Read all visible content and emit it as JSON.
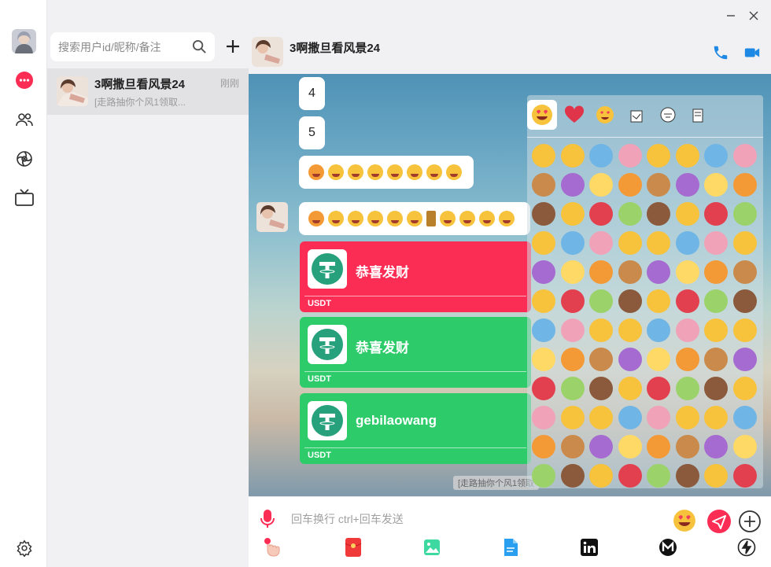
{
  "sidebar": {
    "search_placeholder": "搜索用户id/昵称/备注"
  },
  "contacts": [
    {
      "name": "3啊撒旦看风景24",
      "time": "刚刚",
      "preview": "[走路抽你个风1领取..."
    }
  ],
  "chat": {
    "title": "3啊撒旦看风景24",
    "messages": [
      {
        "text": "4"
      },
      {
        "text": "5"
      }
    ],
    "red_packets": [
      {
        "title": "恭喜发财",
        "currency": "USDT",
        "color": "#fc2d55"
      },
      {
        "title": "恭喜发财",
        "currency": "USDT",
        "color": "#2ecb6a"
      },
      {
        "title": "gebilaowang",
        "currency": "USDT",
        "color": "#2ecb6a"
      }
    ],
    "system_tip": "[走路抽你个风1领取"
  },
  "composer": {
    "placeholder": "回车换行 ctrl+回车发送"
  },
  "colors": {
    "accent_red": "#fc2d55",
    "accent_green": "#2ecb6a",
    "call_blue": "#1e88e5"
  },
  "icons": [
    "chat-icon",
    "contacts-icon",
    "discover-icon",
    "tv-icon",
    "settings-icon",
    "search-icon",
    "plus-icon",
    "phone-icon",
    "video-icon",
    "minimize-icon",
    "close-icon",
    "mic-icon",
    "emoji-icon",
    "send-icon",
    "add-circle-icon",
    "gesture-icon",
    "red-packet-icon",
    "image-icon",
    "file-icon",
    "linkedin-icon",
    "m-icon",
    "flash-icon"
  ]
}
